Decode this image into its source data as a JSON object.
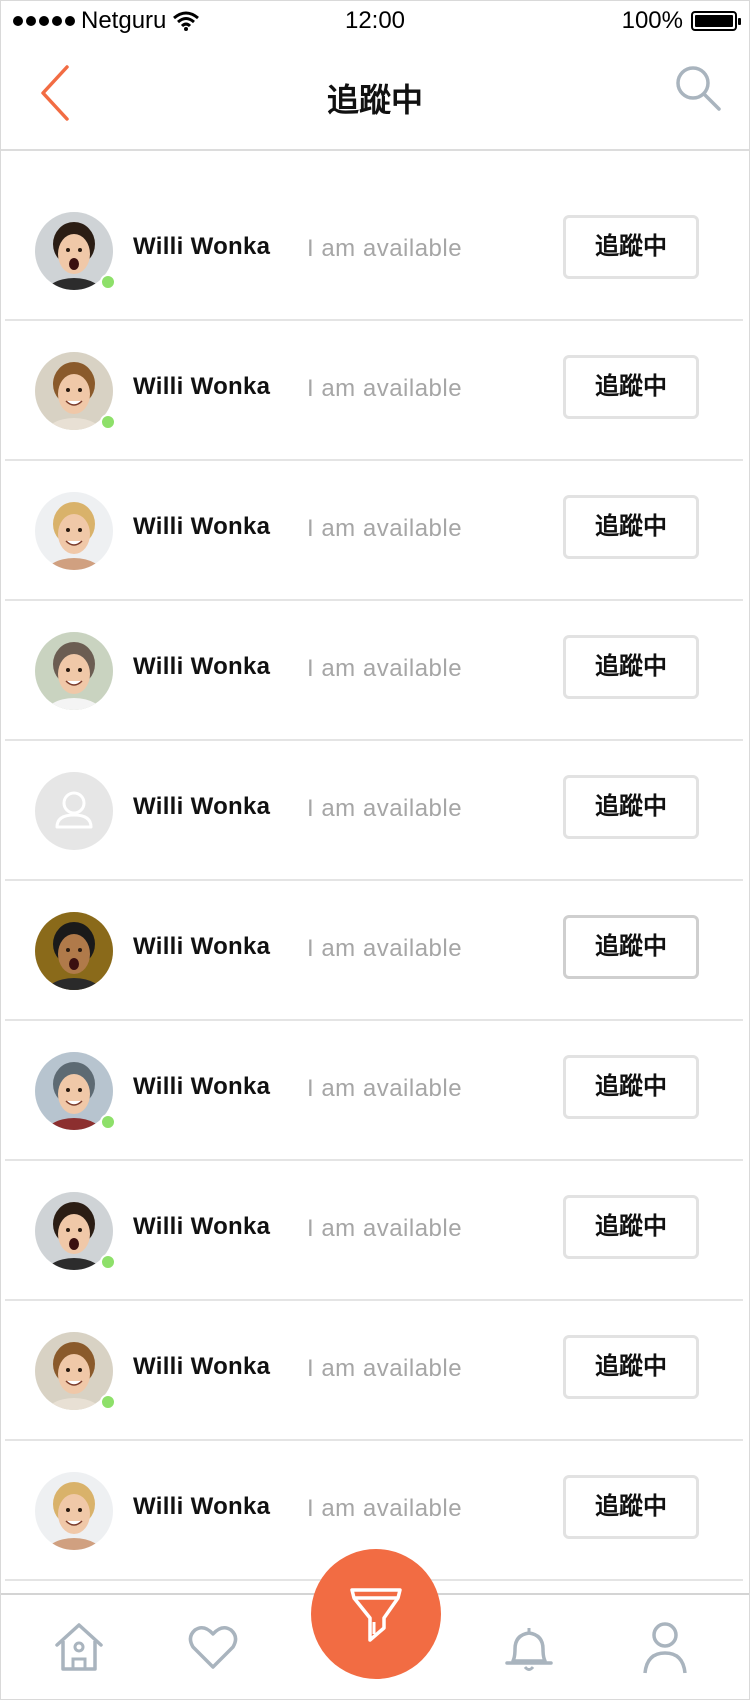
{
  "status_bar": {
    "carrier": "Netguru",
    "time": "12:00",
    "battery": "100%",
    "battery_level": 1.0
  },
  "nav": {
    "title": "追蹤中",
    "back_icon": "chevron-left-icon",
    "search_icon": "search-icon"
  },
  "colors": {
    "accent": "#f26c43",
    "online": "#8ee06a",
    "status_text": "#a6a6a6",
    "divider": "#e4e4e4"
  },
  "follows": [
    {
      "name": "Willi Wonka",
      "status": "I am available",
      "button": "追蹤中",
      "online": true,
      "avatar": "woman-dark-hair"
    },
    {
      "name": "Willi Wonka",
      "status": "I am available",
      "button": "追蹤中",
      "online": true,
      "avatar": "woman-auburn-hair"
    },
    {
      "name": "Willi Wonka",
      "status": "I am available",
      "button": "追蹤中",
      "online": false,
      "avatar": "woman-blonde-hair"
    },
    {
      "name": "Willi Wonka",
      "status": "I am available",
      "button": "追蹤中",
      "online": false,
      "avatar": "man-grey-hair"
    },
    {
      "name": "Willi Wonka",
      "status": "I am available",
      "button": "追蹤中",
      "online": false,
      "avatar": "placeholder"
    },
    {
      "name": "Willi Wonka",
      "status": "I am available",
      "button": "追蹤中",
      "online": false,
      "avatar": "man-surprised"
    },
    {
      "name": "Willi Wonka",
      "status": "I am available",
      "button": "追蹤中",
      "online": true,
      "avatar": "man-beanie"
    },
    {
      "name": "Willi Wonka",
      "status": "I am available",
      "button": "追蹤中",
      "online": true,
      "avatar": "woman-dark-hair"
    },
    {
      "name": "Willi Wonka",
      "status": "I am available",
      "button": "追蹤中",
      "online": true,
      "avatar": "woman-auburn-hair"
    },
    {
      "name": "Willi Wonka",
      "status": "I am available",
      "button": "追蹤中",
      "online": false,
      "avatar": "woman-blonde-hair"
    }
  ],
  "tab_bar": {
    "tabs": [
      "home-icon",
      "heart-icon",
      "filter-icon",
      "bell-icon",
      "user-icon"
    ]
  }
}
